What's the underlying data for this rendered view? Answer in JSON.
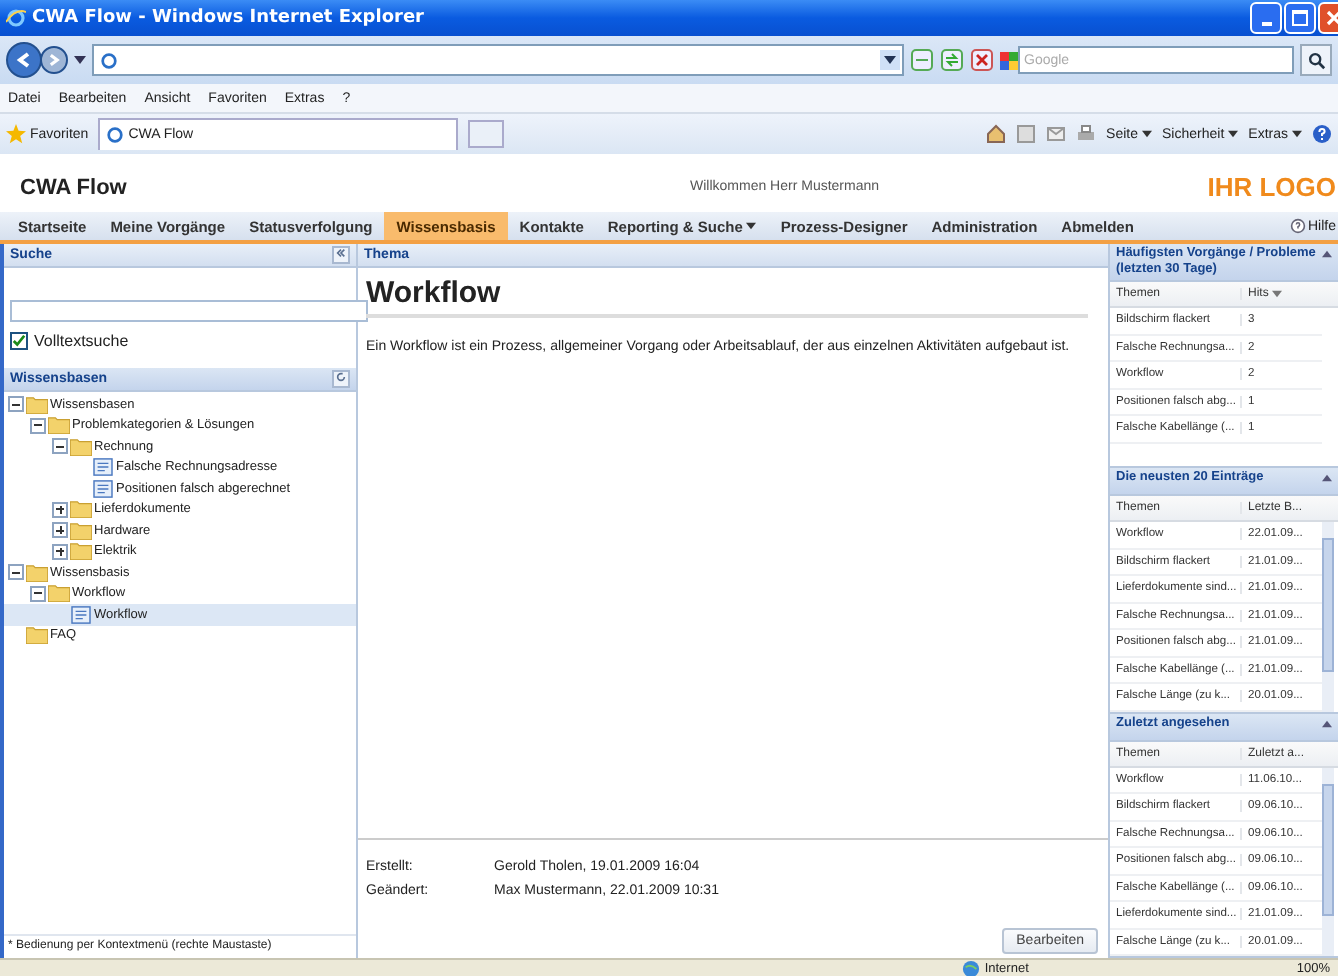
{
  "browser": {
    "title": "CWA Flow - Windows Internet Explorer",
    "search_placeholder": "Google",
    "menu": [
      "Datei",
      "Bearbeiten",
      "Ansicht",
      "Favoriten",
      "Extras",
      "?"
    ],
    "favorites": "Favoriten",
    "tab": "CWA Flow",
    "tools": [
      "Seite",
      "Sicherheit",
      "Extras"
    ],
    "status_zone": "Internet",
    "zoom": "100%"
  },
  "app": {
    "name": "CWA Flow",
    "welcome": "Willkommen Herr Mustermann",
    "logo": "IHR LOGO",
    "help": "Hilfe"
  },
  "nav": [
    {
      "label": "Startseite",
      "selected": false,
      "menu": false
    },
    {
      "label": "Meine Vorgänge",
      "selected": false,
      "menu": false
    },
    {
      "label": "Statusverfolgung",
      "selected": false,
      "menu": false
    },
    {
      "label": "Wissensbasis",
      "selected": true,
      "menu": false
    },
    {
      "label": "Kontakte",
      "selected": false,
      "menu": false
    },
    {
      "label": "Reporting & Suche",
      "selected": false,
      "menu": true
    },
    {
      "label": "Prozess-Designer",
      "selected": false,
      "menu": false
    },
    {
      "label": "Administration",
      "selected": false,
      "menu": false
    },
    {
      "label": "Abmelden",
      "selected": false,
      "menu": false
    }
  ],
  "search": {
    "title": "Suche",
    "fulltext": {
      "label": "Volltextsuche",
      "checked": true
    }
  },
  "knowledge": {
    "title": "Wissensbasen",
    "tree": [
      {
        "label": "Wissensbasen",
        "kind": "folder",
        "expanded": true,
        "selected": false,
        "children": [
          {
            "label": "Problemkategorien & Lösungen",
            "kind": "folder",
            "expanded": true,
            "selected": false,
            "children": [
              {
                "label": "Rechnung",
                "kind": "folder",
                "expanded": true,
                "selected": false,
                "children": [
                  {
                    "label": "Falsche Rechnungsadresse",
                    "kind": "document",
                    "selected": false
                  },
                  {
                    "label": "Positionen falsch abgerechnet",
                    "kind": "document",
                    "selected": false
                  }
                ]
              },
              {
                "label": "Lieferdokumente",
                "kind": "folder",
                "expanded": false,
                "selected": false
              },
              {
                "label": "Hardware",
                "kind": "folder",
                "expanded": false,
                "selected": false
              },
              {
                "label": "Elektrik",
                "kind": "folder",
                "expanded": false,
                "selected": false
              }
            ]
          }
        ]
      },
      {
        "label": "Wissensbasis",
        "kind": "folder",
        "expanded": true,
        "selected": false,
        "children": [
          {
            "label": "Workflow",
            "kind": "folder",
            "expanded": true,
            "selected": false,
            "children": [
              {
                "label": "Workflow",
                "kind": "document",
                "selected": true
              }
            ]
          }
        ]
      },
      {
        "label": "FAQ",
        "kind": "folder",
        "selected": false
      }
    ],
    "note": "* Bedienung per Kontextmenü (rechte Maustaste)"
  },
  "topic": {
    "header": "Thema",
    "title": "Workflow",
    "text": "Ein Workflow ist ein Prozess, allgemeiner Vorgang oder Arbeitsablauf, der aus einzelnen Aktivitäten aufgebaut ist.",
    "meta": [
      {
        "label": "Erstellt:",
        "value": "Gerold Tholen, 19.01.2009 16:04"
      },
      {
        "label": "Geändert:",
        "value": "Max Mustermann, 22.01.2009 10:31"
      }
    ],
    "edit_button": "Bearbeiten"
  },
  "panels": [
    {
      "title": "Häufigsten Vorgänge / Probleme (letzten 30 Tage)",
      "columns": [
        {
          "label": "Themen",
          "sorted": false
        },
        {
          "label": "Hits",
          "sorted": true
        }
      ],
      "rows": [
        [
          "Bildschirm flackert",
          "3"
        ],
        [
          "Falsche Rechnungsa...",
          "2"
        ],
        [
          "Workflow",
          "2"
        ],
        [
          "Positionen falsch abg...",
          "1"
        ],
        [
          "Falsche Kabellänge (...",
          "1"
        ]
      ]
    },
    {
      "title": "Die neusten 20 Einträge",
      "columns": [
        {
          "label": "Themen",
          "sorted": false
        },
        {
          "label": "Letzte B...",
          "sorted": false
        }
      ],
      "rows": [
        [
          "Workflow",
          "22.01.09..."
        ],
        [
          "Bildschirm flackert",
          "21.01.09..."
        ],
        [
          "Lieferdokumente sind...",
          "21.01.09..."
        ],
        [
          "Falsche Rechnungsa...",
          "21.01.09..."
        ],
        [
          "Positionen falsch abg...",
          "21.01.09..."
        ],
        [
          "Falsche Kabellänge (...",
          "21.01.09..."
        ],
        [
          "Falsche Länge (zu k...",
          "20.01.09..."
        ]
      ]
    },
    {
      "title": "Zuletzt angesehen",
      "columns": [
        {
          "label": "Themen",
          "sorted": false
        },
        {
          "label": "Zuletzt a...",
          "sorted": false
        }
      ],
      "rows": [
        [
          "Workflow",
          "11.06.10..."
        ],
        [
          "Bildschirm flackert",
          "09.06.10..."
        ],
        [
          "Falsche Rechnungsa...",
          "09.06.10..."
        ],
        [
          "Positionen falsch abg...",
          "09.06.10..."
        ],
        [
          "Falsche Kabellänge (...",
          "09.06.10..."
        ],
        [
          "Lieferdokumente sind...",
          "21.01.09..."
        ],
        [
          "Falsche Länge (zu k...",
          "20.01.09..."
        ]
      ]
    }
  ]
}
